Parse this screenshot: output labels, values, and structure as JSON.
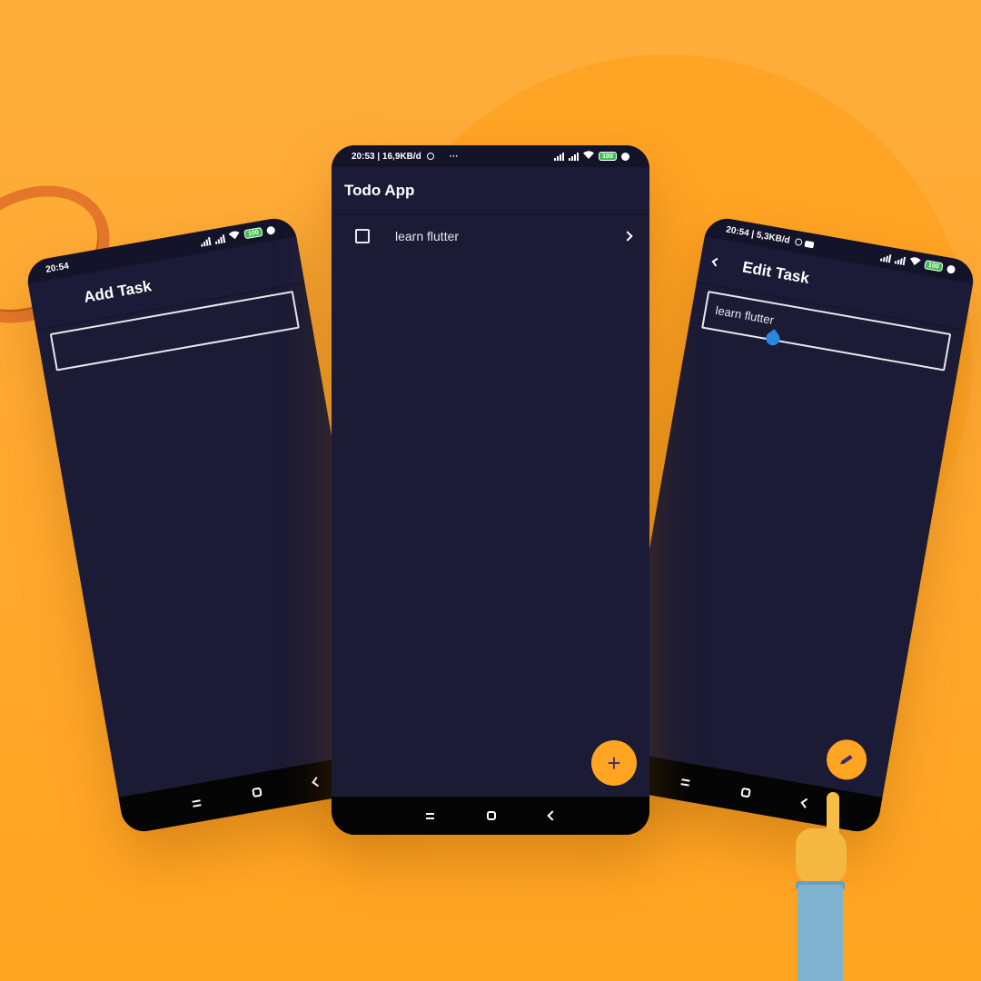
{
  "colors": {
    "background": "#FFAA30",
    "phone_surface": "#1B1B35",
    "accent": "#FFA522",
    "fab_icon": "#3B2C7A",
    "cursor": "#2C86E0",
    "battery": "#3DBE52"
  },
  "left_phone": {
    "status": {
      "time": "20:54",
      "battery": "100"
    },
    "title": "Add Task",
    "input": {
      "value": ""
    },
    "nav_icons": [
      "menu-icon",
      "home-icon",
      "back-icon"
    ]
  },
  "center_phone": {
    "status": {
      "time": "20:53 | 16,9KB/d",
      "more": "···",
      "battery": "100"
    },
    "title": "Todo App",
    "tasks": [
      {
        "title": "learn flutter",
        "done": false
      }
    ],
    "fab": {
      "icon": "plus-icon",
      "glyph": "+"
    },
    "nav_icons": [
      "menu-icon",
      "home-icon",
      "back-icon"
    ]
  },
  "right_phone": {
    "status": {
      "time": "20:54 | 5,3KB/d",
      "battery": "100"
    },
    "title": "Edit Task",
    "input": {
      "value": "learn flutter"
    },
    "fab": {
      "icon": "edit-pencil-icon"
    },
    "nav_icons": [
      "menu-icon",
      "home-icon",
      "back-icon"
    ]
  }
}
